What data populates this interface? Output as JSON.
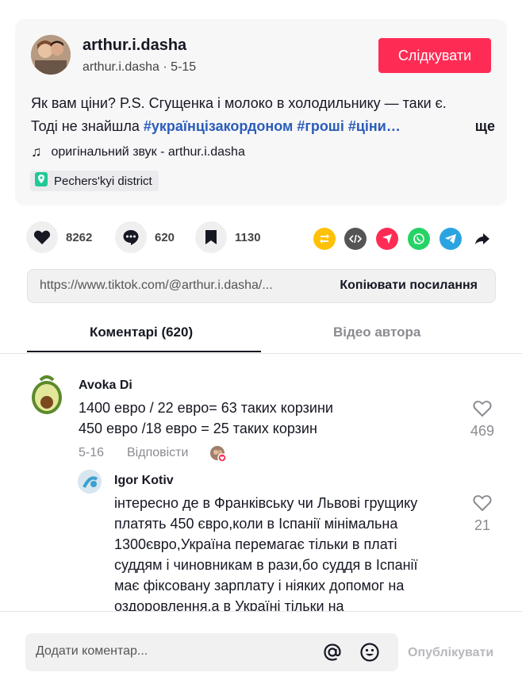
{
  "post": {
    "username": "arthur.i.dasha",
    "subline": "arthur.i.dasha · 5-15",
    "follow_label": "Слідкувати",
    "caption_line1": "Як вам ціни? P.S. Сгущенка і молоко в холодильнику — таки є.",
    "caption_line2_text": "Тоді не знайшла ",
    "caption_tags": "#українцізакордоном #гроші #ціни…",
    "more_label": "ще",
    "sound": "оригінальний звук - arthur.i.dasha",
    "location": "Pechers'kyi district"
  },
  "actions": {
    "likes": "8262",
    "comments": "620",
    "saves": "1130"
  },
  "share_icons": [
    "repost-icon",
    "embed-icon",
    "send-icon",
    "whatsapp-icon",
    "telegram-icon",
    "share-arrow-icon"
  ],
  "colors": {
    "accent": "#fe2c55",
    "hashtag": "#2b5db9",
    "repost": "#ffc107",
    "embed": "#555555",
    "send": "#fe2c55",
    "whatsapp": "#25d366",
    "telegram": "#2aa4e0"
  },
  "link": {
    "url": "https://www.tiktok.com/@arthur.i.dasha/...",
    "copy_label": "Копіювати посилання"
  },
  "tabs": [
    {
      "label": "Коментарі (620)",
      "active": true
    },
    {
      "label": "Відео автора",
      "active": false
    }
  ],
  "comments": [
    {
      "author": "Avoka Di",
      "lines": [
        "1400 евро / 22 евро= 63 таких корзини",
        "450 евро /18 евро = 25 таких корзин"
      ],
      "date": "5-16",
      "reply_label": "Відповісти",
      "likes": "469"
    },
    {
      "author": "Igor Kotiv",
      "lines": [
        "інтересно де в Франківську чи Львові грущику",
        "платять 450 євро,коли в Іспанії мінімальна",
        "1300євро,Україна перемагає тільки в платі",
        "суддям і чиновникам в рази,бо суддя в Іспанії",
        "має фіксовану зарплату і ніяких допомог на",
        "оздоровлення,а в Україні тільки на"
      ],
      "likes": "21"
    }
  ],
  "footer": {
    "placeholder": "Додати коментар...",
    "publish_label": "Опублікувати"
  }
}
